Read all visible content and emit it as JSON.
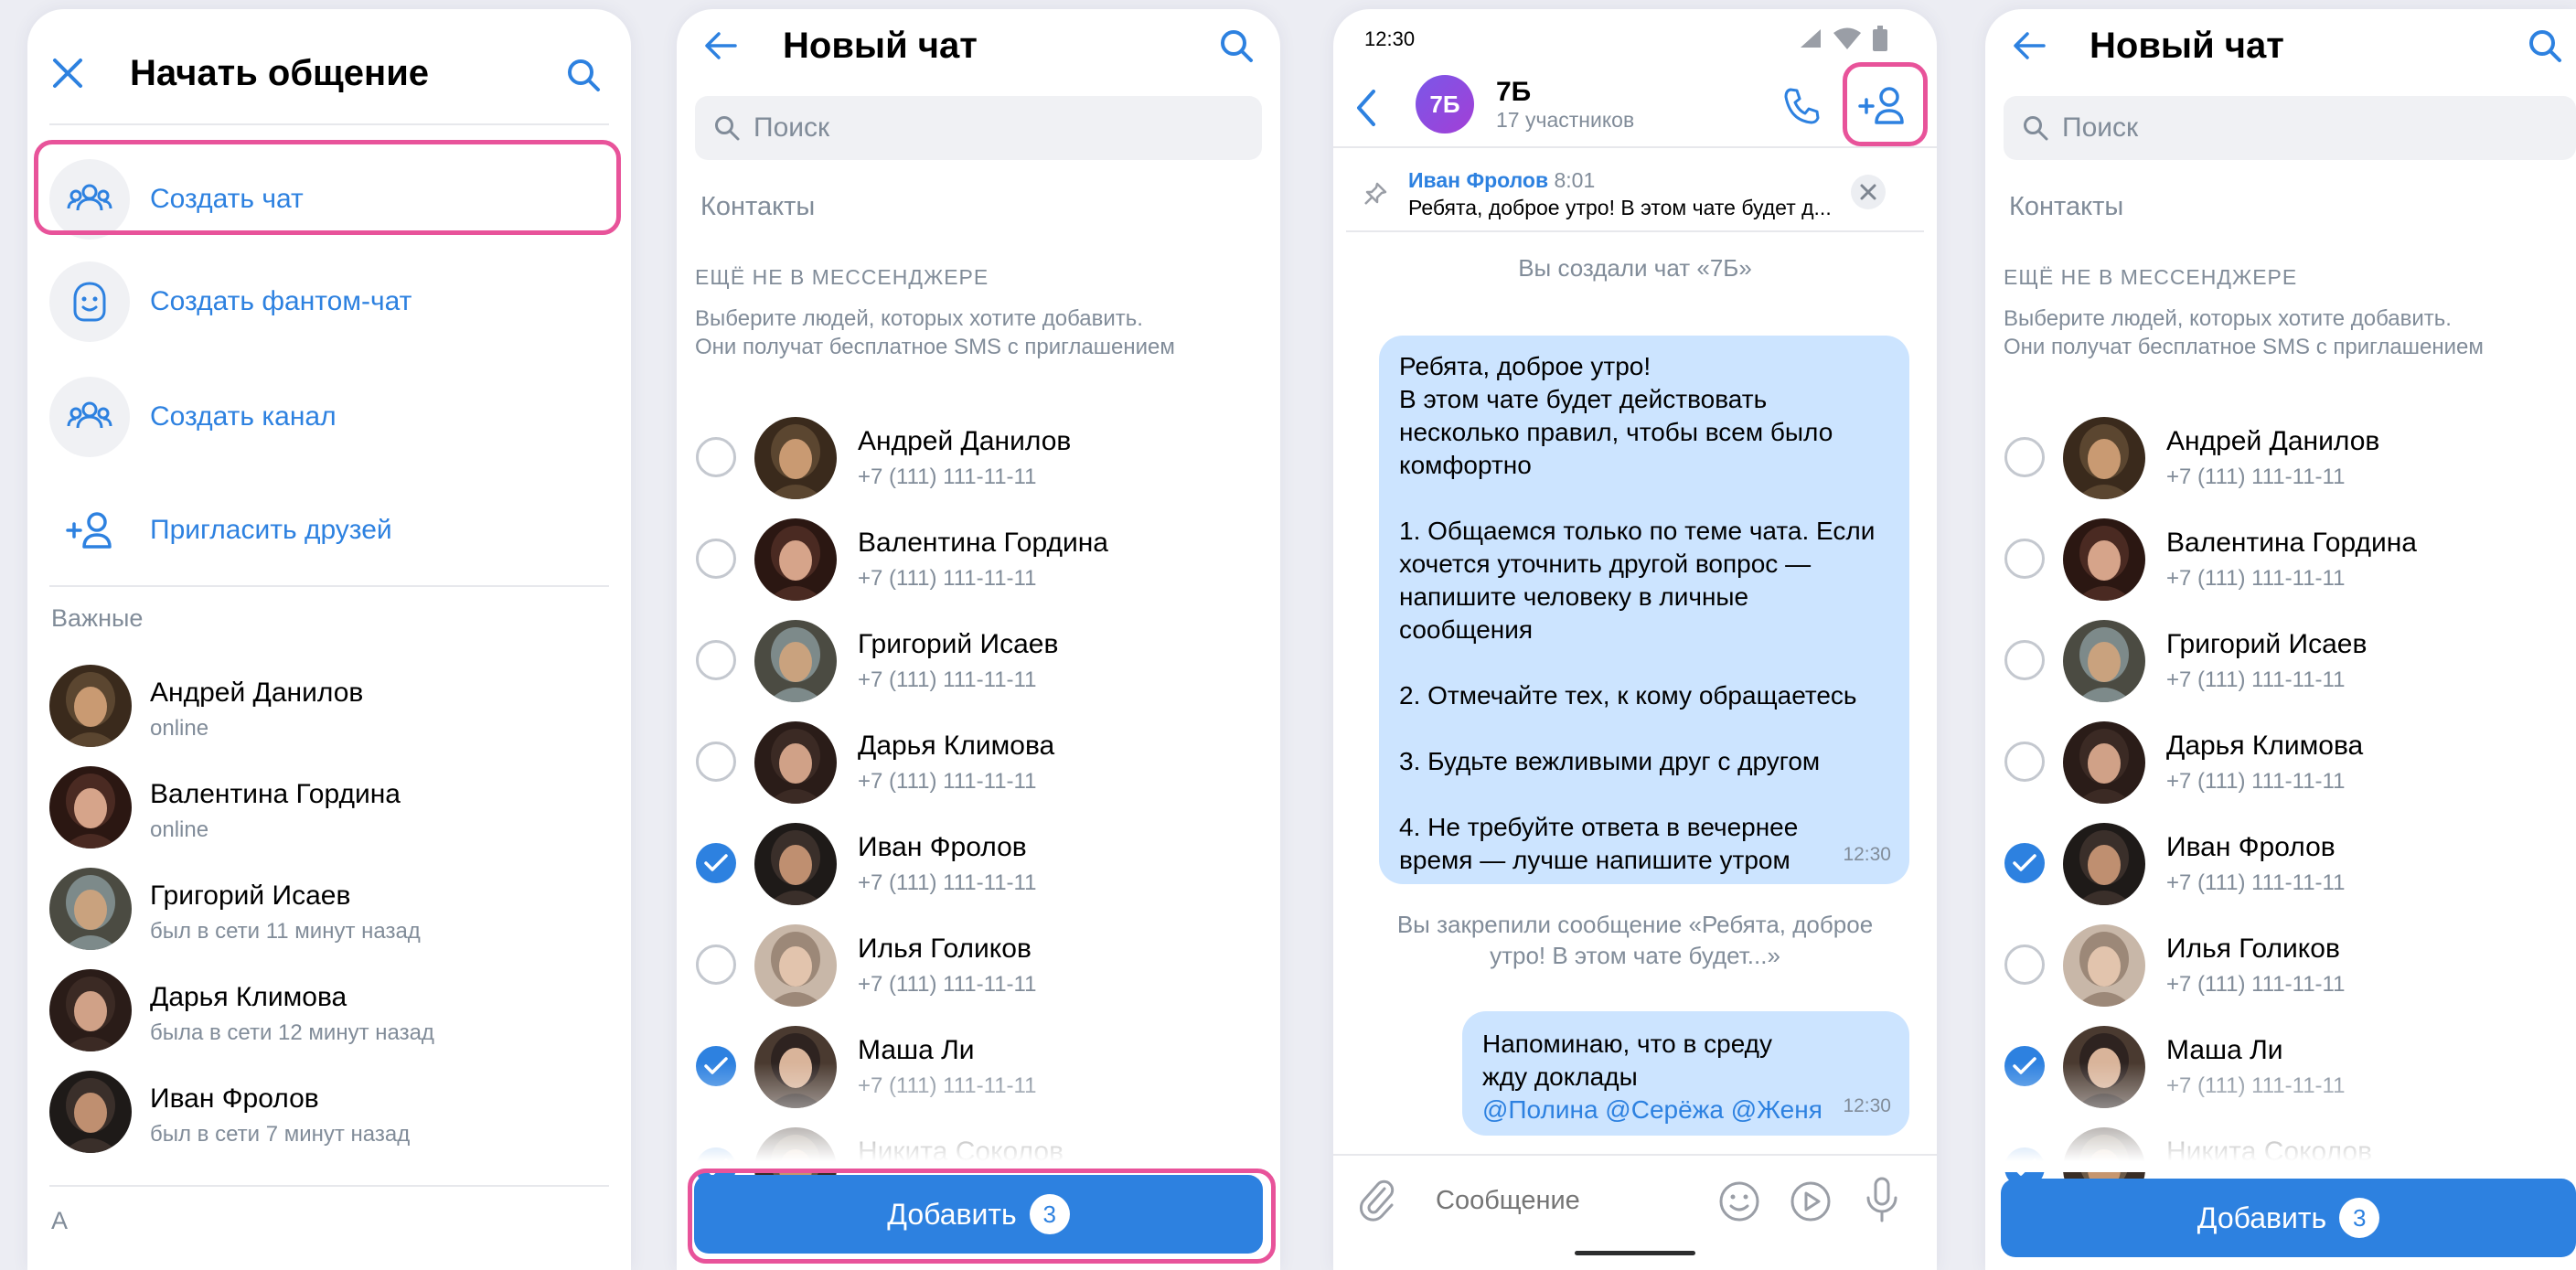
{
  "screen1": {
    "title": "Начать общение",
    "menu": [
      "Создать чат",
      "Создать фантом-чат",
      "Создать канал",
      "Пригласить друзей"
    ],
    "section_label": "Важные",
    "people": [
      {
        "name": "Андрей Данилов",
        "status": "online"
      },
      {
        "name": "Валентина Гордина",
        "status": "online"
      },
      {
        "name": "Григорий Исаев",
        "status": "был в сети 11 минут назад"
      },
      {
        "name": "Дарья Климова",
        "status": "была в сети 12 минут назад"
      },
      {
        "name": "Иван Фролов",
        "status": "был в сети 7 минут назад"
      }
    ],
    "letter": "А"
  },
  "new_chat": {
    "title": "Новый чат",
    "search_placeholder": "Поиск",
    "contacts_label": "Контакты",
    "not_in_messenger": "ЕЩЁ НЕ В МЕССЕНДЖЕРЕ",
    "hint_line1": "Выберите людей, которых хотите добавить.",
    "hint_line2": "Они получат бесплатное  SMS с приглашением",
    "contacts": [
      {
        "name": "Андрей Данилов",
        "phone": "+7 (111) 111-11-11",
        "checked": false
      },
      {
        "name": "Валентина Гордина",
        "phone": "+7 (111) 111-11-11",
        "checked": false
      },
      {
        "name": "Григорий Исаев",
        "phone": "+7 (111) 111-11-11",
        "checked": false
      },
      {
        "name": "Дарья Климова",
        "phone": "+7 (111) 111-11-11",
        "checked": false
      },
      {
        "name": "Иван Фролов",
        "phone": "+7 (111) 111-11-11",
        "checked": true
      },
      {
        "name": "Илья Голиков",
        "phone": "+7 (111) 111-11-11",
        "checked": false
      },
      {
        "name": "Маша Ли",
        "phone": "+7 (111) 111-11-11",
        "checked": true
      },
      {
        "name": "Никита Соколов",
        "phone": "",
        "checked": true
      }
    ],
    "add_label": "Добавить",
    "add_count": "3"
  },
  "chat": {
    "time": "12:30",
    "avatar_text": "7Б",
    "name": "7Б",
    "members": "17 участников",
    "pinned_author": "Иван Фролов",
    "pinned_time": "8:01",
    "pinned_text": "Ребята, доброе утро! В этом чате будет д...",
    "created_notice": "Вы создали чат «7Б»",
    "message1_lines": [
      "Ребята, доброе утро!",
      "В этом чате будет действовать",
      "несколько правил, чтобы всем было",
      "комфортно",
      "",
      "1. Общаемся только по теме чата. Если",
      "хочется уточнить другой вопрос —",
      "напишите человеку в личные",
      "сообщения",
      "",
      "2. Отмечайте тех, к кому обращаетесь",
      "",
      "3. Будьте вежливыми друг с другом",
      "",
      "4. Не требуйте ответа в вечернее",
      "время — лучше напишите утром"
    ],
    "message1_time": "12:30",
    "pin_notice_line1": "Вы закрепили сообщение «Ребята, доброе",
    "pin_notice_line2": "утро! В этом чате будет...»",
    "message2_line1": "Напоминаю, что в среду",
    "message2_line2": "жду доклады",
    "message2_mentions": "@Полина @Серёжа @Женя",
    "message2_time": "12:30",
    "input_placeholder": "Сообщение"
  },
  "colors": {
    "accent": "#2d81e0",
    "highlight": "#e8539a",
    "bubble": "#cce4ff",
    "secondary_text": "#818c99"
  }
}
